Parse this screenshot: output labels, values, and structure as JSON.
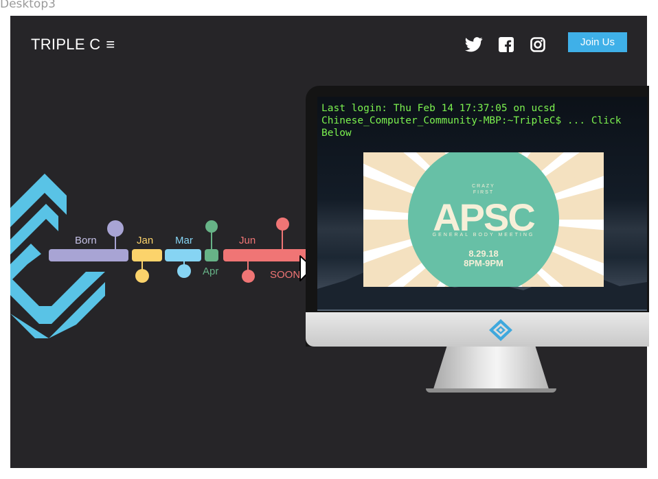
{
  "frame": {
    "label": "Desktop3"
  },
  "header": {
    "brand": "TRIPLE C",
    "menu_icon": "≡",
    "social_icons": [
      "twitter-icon",
      "facebook-icon",
      "instagram-icon"
    ],
    "join_label": "Join Us"
  },
  "timeline": {
    "items": [
      {
        "label": "Born",
        "color": "#a8a4d4"
      },
      {
        "label": "Jan",
        "color": "#fcd36b"
      },
      {
        "label": "Mar",
        "color": "#86d4f3"
      },
      {
        "label": "Apr",
        "color": "#67b387"
      },
      {
        "label": "Jun",
        "color": "#f07575"
      },
      {
        "label": "SOON",
        "color": "#f07575"
      }
    ]
  },
  "terminal": {
    "lines": [
      "Last login: Thu Feb 14 17:37:05 on ucsd",
      "Chinese_Computer_Community-MBP:~TripleC$ ... Click",
      "Below"
    ]
  },
  "poster": {
    "eyebrow_1": "CRAZY",
    "eyebrow_2": "FIRST",
    "title": "APSC",
    "subtitle": "GENERAL BODY MEETING",
    "date": "8.29.18",
    "time": "8PM-9PM",
    "colors": {
      "teal": "#67c0a6",
      "cream": "#f4e1c0",
      "white": "#ffffff"
    }
  },
  "colors": {
    "page_bg": "#262528",
    "accent": "#3fb0e8",
    "logo": "#59c3e6",
    "terminal_text": "#7cf24f"
  }
}
